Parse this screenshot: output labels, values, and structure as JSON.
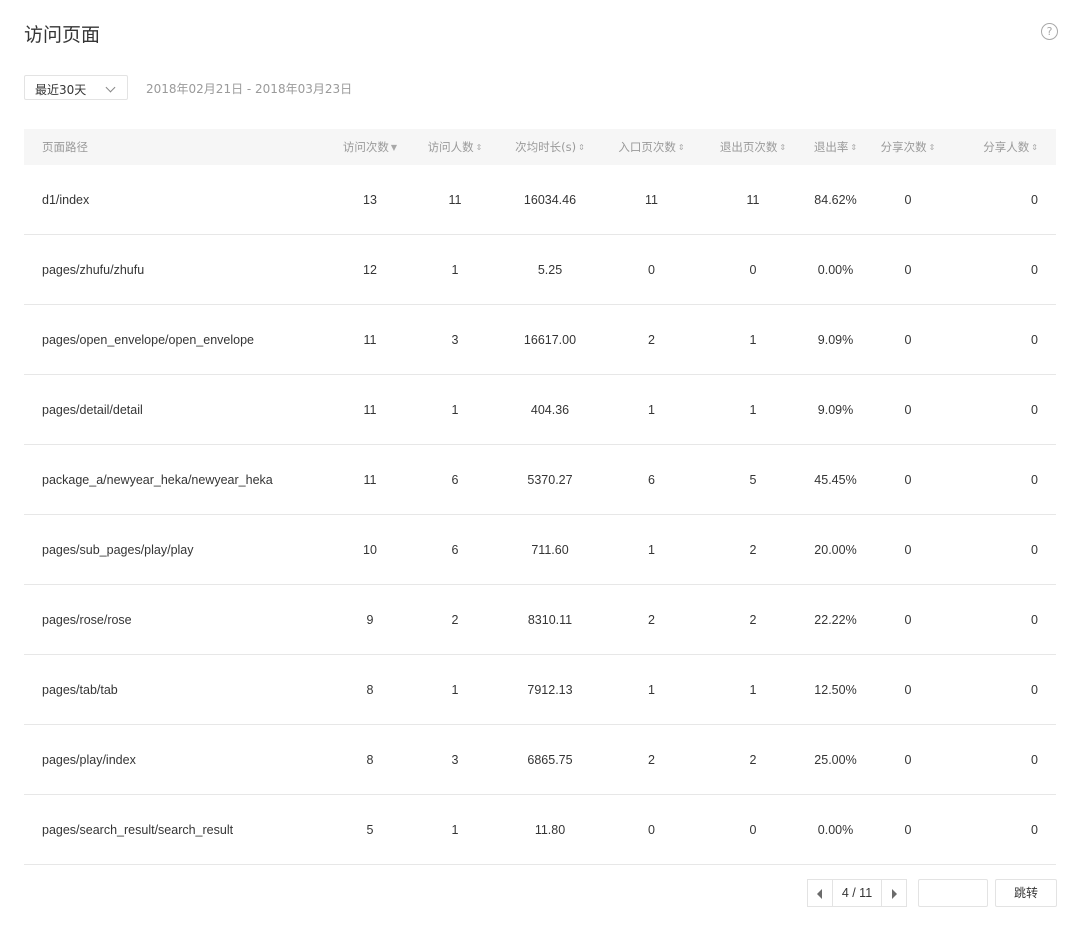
{
  "header": {
    "title": "访问页面",
    "help_icon": "?"
  },
  "filters": {
    "range_select": "最近30天",
    "date_range": "2018年02月21日 - 2018年03月23日"
  },
  "table": {
    "columns": [
      {
        "label": "页面路径",
        "sort": "none"
      },
      {
        "label": "访问次数",
        "sort": "desc"
      },
      {
        "label": "访问人数",
        "sort": "both"
      },
      {
        "label": "次均时长(s)",
        "sort": "both"
      },
      {
        "label": "入口页次数",
        "sort": "both"
      },
      {
        "label": "退出页次数",
        "sort": "both"
      },
      {
        "label": "退出率",
        "sort": "both"
      },
      {
        "label": "分享次数",
        "sort": "both"
      },
      {
        "label": "分享人数",
        "sort": "both"
      }
    ],
    "sort_icons": {
      "desc": "▼",
      "both": "⇕"
    },
    "rows": [
      [
        "d1/index",
        "13",
        "11",
        "16034.46",
        "11",
        "11",
        "84.62%",
        "0",
        "0"
      ],
      [
        "pages/zhufu/zhufu",
        "12",
        "1",
        "5.25",
        "0",
        "0",
        "0.00%",
        "0",
        "0"
      ],
      [
        "pages/open_envelope/open_envelope",
        "11",
        "3",
        "16617.00",
        "2",
        "1",
        "9.09%",
        "0",
        "0"
      ],
      [
        "pages/detail/detail",
        "11",
        "1",
        "404.36",
        "1",
        "1",
        "9.09%",
        "0",
        "0"
      ],
      [
        "package_a/newyear_heka/newyear_heka",
        "11",
        "6",
        "5370.27",
        "6",
        "5",
        "45.45%",
        "0",
        "0"
      ],
      [
        "pages/sub_pages/play/play",
        "10",
        "6",
        "711.60",
        "1",
        "2",
        "20.00%",
        "0",
        "0"
      ],
      [
        "pages/rose/rose",
        "9",
        "2",
        "8310.11",
        "2",
        "2",
        "22.22%",
        "0",
        "0"
      ],
      [
        "pages/tab/tab",
        "8",
        "1",
        "7912.13",
        "1",
        "1",
        "12.50%",
        "0",
        "0"
      ],
      [
        "pages/play/index",
        "8",
        "3",
        "6865.75",
        "2",
        "2",
        "25.00%",
        "0",
        "0"
      ],
      [
        "pages/search_result/search_result",
        "5",
        "1",
        "11.80",
        "0",
        "0",
        "0.00%",
        "0",
        "0"
      ]
    ]
  },
  "pagination": {
    "current": "4 / 11",
    "jump_value": "",
    "jump_label": "跳转"
  }
}
